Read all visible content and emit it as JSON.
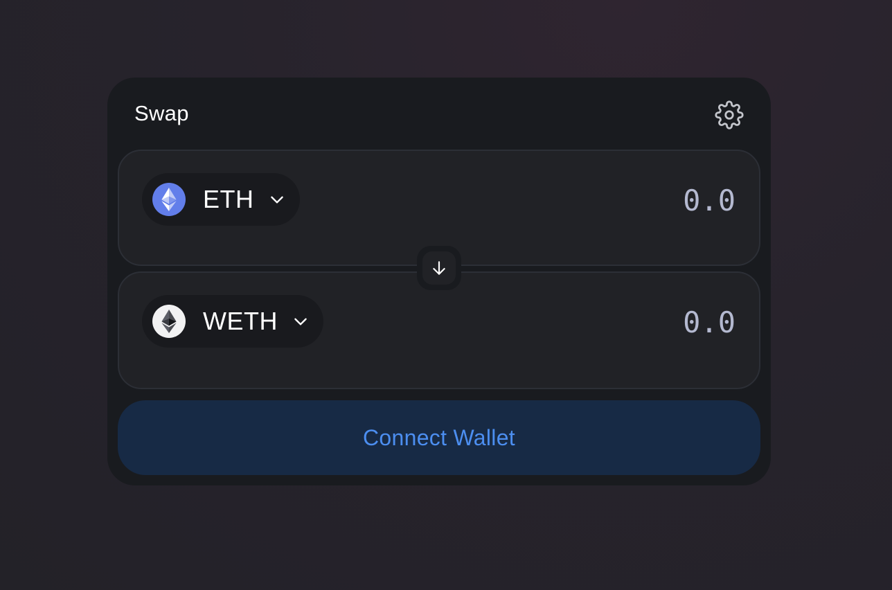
{
  "swap": {
    "title": "Swap",
    "settings_icon": "gear-icon"
  },
  "input_token": {
    "symbol": "ETH",
    "icon": "eth-logo-icon",
    "amount_placeholder": "0.0"
  },
  "output_token": {
    "symbol": "WETH",
    "icon": "weth-logo-icon",
    "amount_placeholder": "0.0"
  },
  "switch": {
    "icon": "arrow-down-icon"
  },
  "connect": {
    "label": "Connect Wallet"
  },
  "colors": {
    "background": "#27232c",
    "card": "#191b1f",
    "panel": "#212226",
    "accent": "#4c8ef0",
    "accent_bg": "#172a45",
    "eth_blue": "#627eea"
  }
}
